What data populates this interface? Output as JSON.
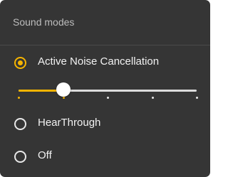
{
  "header": {
    "title": "Sound modes"
  },
  "modes": [
    {
      "label": "Active Noise Cancellation",
      "selected": true
    },
    {
      "label": "HearThrough",
      "selected": false
    },
    {
      "label": "Off",
      "selected": false
    }
  ],
  "anc_level": {
    "value": 1,
    "min": 0,
    "max": 4,
    "steps": 5
  },
  "colors": {
    "accent": "#f5b400",
    "panel_bg": "#353535",
    "text": "#f2f2f2",
    "muted_text": "#bdbdbd"
  }
}
